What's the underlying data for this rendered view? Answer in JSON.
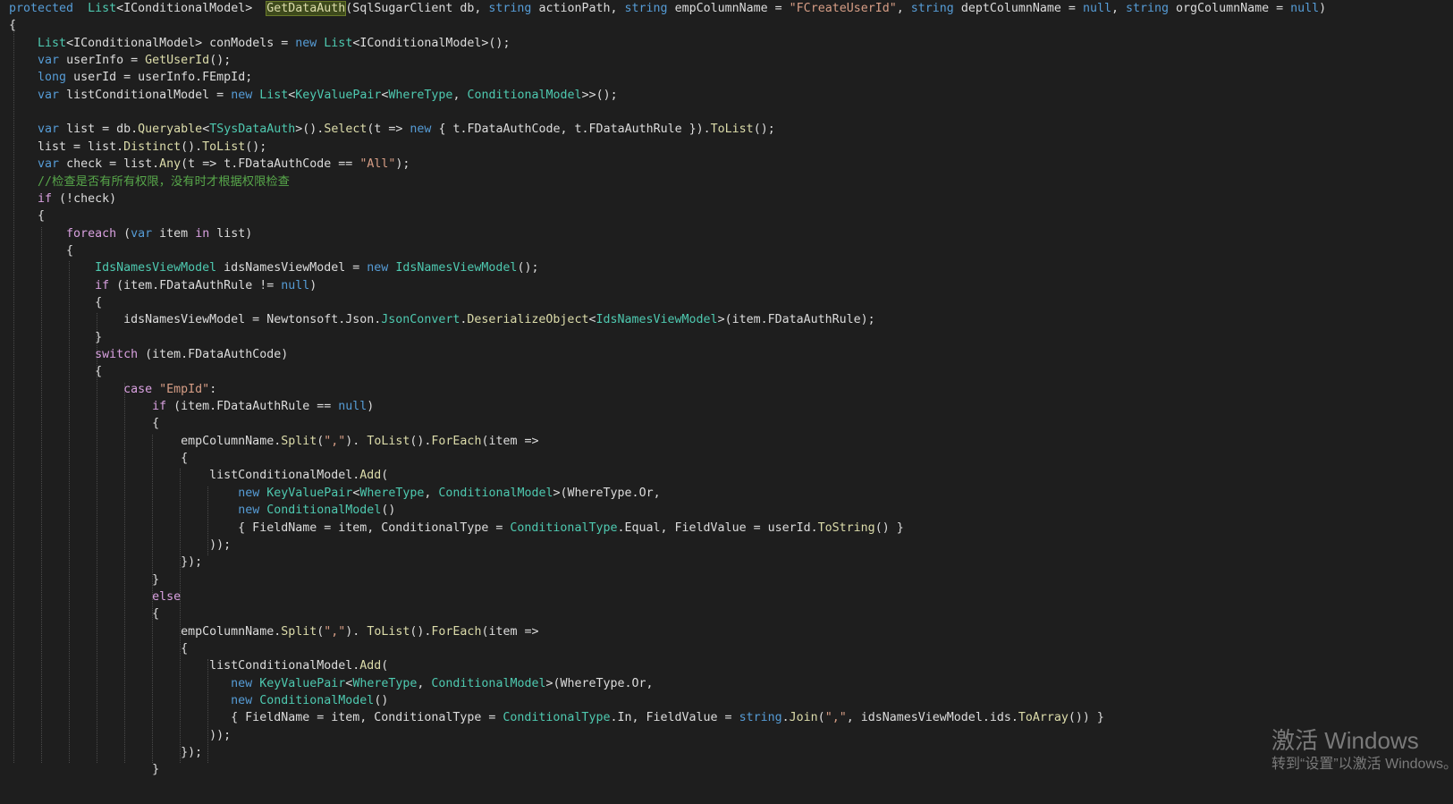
{
  "editor": {
    "lines": [
      [
        [
          "kw",
          "protected"
        ],
        [
          "",
          "  "
        ],
        [
          "ty",
          "List"
        ],
        [
          "",
          "<IConditionalModel>  "
        ],
        [
          "hl",
          "GetDataAuth"
        ],
        [
          "",
          "(SqlSugarClient db, "
        ],
        [
          "kw",
          "string"
        ],
        [
          "",
          " actionPath, "
        ],
        [
          "kw",
          "string"
        ],
        [
          "",
          " empColumnName = "
        ],
        [
          "st",
          "\"FCreateUserId\""
        ],
        [
          "",
          ", "
        ],
        [
          "kw",
          "string"
        ],
        [
          "",
          " deptColumnName = "
        ],
        [
          "kw",
          "null"
        ],
        [
          "",
          ", "
        ],
        [
          "kw",
          "string"
        ],
        [
          "",
          " orgColumnName = "
        ],
        [
          "kw",
          "null"
        ],
        [
          "",
          ")"
        ]
      ],
      [
        [
          "",
          "{"
        ]
      ],
      [
        [
          "",
          "    "
        ],
        [
          "ty",
          "List"
        ],
        [
          "",
          "<IConditionalModel> conModels = "
        ],
        [
          "kw",
          "new"
        ],
        [
          "",
          " "
        ],
        [
          "ty",
          "List"
        ],
        [
          "",
          "<IConditionalModel>();"
        ]
      ],
      [
        [
          "",
          "    "
        ],
        [
          "kw",
          "var"
        ],
        [
          "",
          " userInfo = "
        ],
        [
          "mt",
          "GetUserId"
        ],
        [
          "",
          "();"
        ]
      ],
      [
        [
          "",
          "    "
        ],
        [
          "kw",
          "long"
        ],
        [
          "",
          " userId = userInfo.FEmpId;"
        ]
      ],
      [
        [
          "",
          "    "
        ],
        [
          "kw",
          "var"
        ],
        [
          "",
          " listConditionalModel = "
        ],
        [
          "kw",
          "new"
        ],
        [
          "",
          " "
        ],
        [
          "ty",
          "List"
        ],
        [
          "",
          "<"
        ],
        [
          "ty",
          "KeyValuePair"
        ],
        [
          "",
          "<"
        ],
        [
          "ty",
          "WhereType"
        ],
        [
          "",
          ", "
        ],
        [
          "ty",
          "ConditionalModel"
        ],
        [
          "",
          ">>();"
        ]
      ],
      [],
      [
        [
          "",
          "    "
        ],
        [
          "kw",
          "var"
        ],
        [
          "",
          " list = db."
        ],
        [
          "mt",
          "Queryable"
        ],
        [
          "",
          "<"
        ],
        [
          "ty",
          "TSysDataAuth"
        ],
        [
          "",
          ">()."
        ],
        [
          "mt",
          "Select"
        ],
        [
          "",
          "(t => "
        ],
        [
          "kw",
          "new"
        ],
        [
          "",
          " { t.FDataAuthCode, t.FDataAuthRule })."
        ],
        [
          "mt",
          "ToList"
        ],
        [
          "",
          "();"
        ]
      ],
      [
        [
          "",
          "    list = list."
        ],
        [
          "mt",
          "Distinct"
        ],
        [
          "",
          "()."
        ],
        [
          "mt",
          "ToList"
        ],
        [
          "",
          "();"
        ]
      ],
      [
        [
          "",
          "    "
        ],
        [
          "kw",
          "var"
        ],
        [
          "",
          " check = list."
        ],
        [
          "mt",
          "Any"
        ],
        [
          "",
          "(t => t.FDataAuthCode == "
        ],
        [
          "st",
          "\"All\""
        ],
        [
          "",
          ");"
        ]
      ],
      [
        [
          "",
          "    "
        ],
        [
          "cm",
          "//检查是否有所有权限，没有时才根据权限检查"
        ]
      ],
      [
        [
          "",
          "    "
        ],
        [
          "ct",
          "if"
        ],
        [
          "",
          " (!check)"
        ]
      ],
      [
        [
          "",
          "    {"
        ]
      ],
      [
        [
          "",
          "        "
        ],
        [
          "ct",
          "foreach"
        ],
        [
          "",
          " ("
        ],
        [
          "kw",
          "var"
        ],
        [
          "",
          " item "
        ],
        [
          "ct",
          "in"
        ],
        [
          "",
          " list)"
        ]
      ],
      [
        [
          "",
          "        {"
        ]
      ],
      [
        [
          "",
          "            "
        ],
        [
          "ty",
          "IdsNamesViewModel"
        ],
        [
          "",
          " idsNamesViewModel = "
        ],
        [
          "kw",
          "new"
        ],
        [
          "",
          " "
        ],
        [
          "ty",
          "IdsNamesViewModel"
        ],
        [
          "",
          "();"
        ]
      ],
      [
        [
          "",
          "            "
        ],
        [
          "ct",
          "if"
        ],
        [
          "",
          " (item.FDataAuthRule != "
        ],
        [
          "kw",
          "null"
        ],
        [
          "",
          ")"
        ]
      ],
      [
        [
          "",
          "            {"
        ]
      ],
      [
        [
          "",
          "                idsNamesViewModel = Newtonsoft.Json."
        ],
        [
          "ty",
          "JsonConvert"
        ],
        [
          "",
          "."
        ],
        [
          "mt",
          "DeserializeObject"
        ],
        [
          "",
          "<"
        ],
        [
          "ty",
          "IdsNamesViewModel"
        ],
        [
          "",
          ">(item.FDataAuthRule);"
        ]
      ],
      [
        [
          "",
          "            }"
        ]
      ],
      [
        [
          "",
          "            "
        ],
        [
          "ct",
          "switch"
        ],
        [
          "",
          " (item.FDataAuthCode)"
        ]
      ],
      [
        [
          "",
          "            {"
        ]
      ],
      [
        [
          "",
          "                "
        ],
        [
          "ct",
          "case"
        ],
        [
          "",
          " "
        ],
        [
          "st",
          "\"EmpId\""
        ],
        [
          "",
          ":"
        ]
      ],
      [
        [
          "",
          "                    "
        ],
        [
          "ct",
          "if"
        ],
        [
          "",
          " (item.FDataAuthRule == "
        ],
        [
          "kw",
          "null"
        ],
        [
          "",
          ")"
        ]
      ],
      [
        [
          "",
          "                    {"
        ]
      ],
      [
        [
          "",
          "                        empColumnName."
        ],
        [
          "mt",
          "Split"
        ],
        [
          "",
          "("
        ],
        [
          "st",
          "\",\""
        ],
        [
          "",
          "). "
        ],
        [
          "mt",
          "ToList"
        ],
        [
          "",
          "()."
        ],
        [
          "mt",
          "ForEach"
        ],
        [
          "",
          "(item =>"
        ]
      ],
      [
        [
          "",
          "                        {"
        ]
      ],
      [
        [
          "",
          "                            listConditionalModel."
        ],
        [
          "mt",
          "Add"
        ],
        [
          "",
          "("
        ]
      ],
      [
        [
          "",
          "                                "
        ],
        [
          "kw",
          "new"
        ],
        [
          "",
          " "
        ],
        [
          "ty",
          "KeyValuePair"
        ],
        [
          "",
          "<"
        ],
        [
          "ty",
          "WhereType"
        ],
        [
          "",
          ", "
        ],
        [
          "ty",
          "ConditionalModel"
        ],
        [
          "",
          ">(WhereType.Or,"
        ]
      ],
      [
        [
          "",
          "                                "
        ],
        [
          "kw",
          "new"
        ],
        [
          "",
          " "
        ],
        [
          "ty",
          "ConditionalModel"
        ],
        [
          "",
          "()"
        ]
      ],
      [
        [
          "",
          "                                { FieldName = item, ConditionalType = "
        ],
        [
          "ty",
          "ConditionalType"
        ],
        [
          "",
          ".Equal, FieldValue = userId."
        ],
        [
          "mt",
          "ToString"
        ],
        [
          "",
          "() }"
        ]
      ],
      [
        [
          "",
          "                            ));"
        ]
      ],
      [
        [
          "",
          "                        });"
        ]
      ],
      [
        [
          "",
          "                    }"
        ]
      ],
      [
        [
          "",
          "                    "
        ],
        [
          "ct",
          "else"
        ]
      ],
      [
        [
          "",
          "                    {"
        ]
      ],
      [
        [
          "",
          "                        empColumnName."
        ],
        [
          "mt",
          "Split"
        ],
        [
          "",
          "("
        ],
        [
          "st",
          "\",\""
        ],
        [
          "",
          "). "
        ],
        [
          "mt",
          "ToList"
        ],
        [
          "",
          "()."
        ],
        [
          "mt",
          "ForEach"
        ],
        [
          "",
          "(item =>"
        ]
      ],
      [
        [
          "",
          "                        {"
        ]
      ],
      [
        [
          "",
          "                            listConditionalModel."
        ],
        [
          "mt",
          "Add"
        ],
        [
          "",
          "("
        ]
      ],
      [
        [
          "",
          "                               "
        ],
        [
          "kw",
          "new"
        ],
        [
          "",
          " "
        ],
        [
          "ty",
          "KeyValuePair"
        ],
        [
          "",
          "<"
        ],
        [
          "ty",
          "WhereType"
        ],
        [
          "",
          ", "
        ],
        [
          "ty",
          "ConditionalModel"
        ],
        [
          "",
          ">(WhereType.Or,"
        ]
      ],
      [
        [
          "",
          "                               "
        ],
        [
          "kw",
          "new"
        ],
        [
          "",
          " "
        ],
        [
          "ty",
          "ConditionalModel"
        ],
        [
          "",
          "()"
        ]
      ],
      [
        [
          "",
          "                               { FieldName = item, ConditionalType = "
        ],
        [
          "ty",
          "ConditionalType"
        ],
        [
          "",
          ".In, FieldValue = "
        ],
        [
          "kw",
          "string"
        ],
        [
          "",
          "."
        ],
        [
          "mt",
          "Join"
        ],
        [
          "",
          "("
        ],
        [
          "st",
          "\",\""
        ],
        [
          "",
          ", idsNamesViewModel.ids."
        ],
        [
          "mt",
          "ToArray"
        ],
        [
          "",
          "()) }"
        ]
      ],
      [
        [
          "",
          "                            ));"
        ]
      ],
      [
        [
          "",
          "                        });"
        ]
      ],
      [
        [
          "",
          "                    }"
        ]
      ]
    ]
  },
  "watermark": {
    "title": "激活 Windows",
    "subtitle": "转到“设置”以激活 Windows。"
  }
}
